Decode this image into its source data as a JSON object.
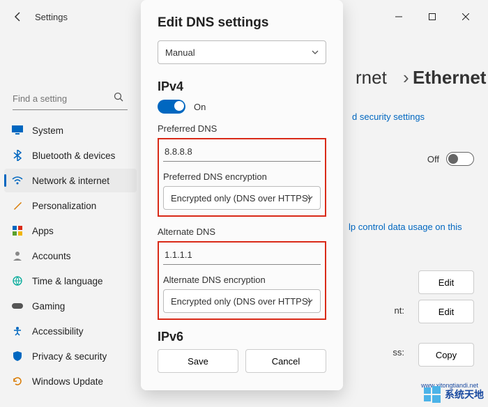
{
  "titlebar": {
    "title": "Settings"
  },
  "search": {
    "placeholder": "Find a setting"
  },
  "sidebar": {
    "items": [
      {
        "label": "System"
      },
      {
        "label": "Bluetooth & devices"
      },
      {
        "label": "Network & internet"
      },
      {
        "label": "Personalization"
      },
      {
        "label": "Apps"
      },
      {
        "label": "Accounts"
      },
      {
        "label": "Time & language"
      },
      {
        "label": "Gaming"
      },
      {
        "label": "Accessibility"
      },
      {
        "label": "Privacy & security"
      },
      {
        "label": "Windows Update"
      }
    ]
  },
  "breadcrumb": {
    "parent_partial": "rnet",
    "current": "Ethernet"
  },
  "main": {
    "security_link": "d security settings",
    "off_label": "Off",
    "usage_link": "lp control data usage on this",
    "edit_label": "Edit",
    "copy_label": "Copy",
    "nt_label": "nt:",
    "ss_label": "ss:"
  },
  "dialog": {
    "title": "Edit DNS settings",
    "mode_value": "Manual",
    "ipv4_header": "IPv4",
    "ipv4_toggle_label": "On",
    "preferred_dns_label": "Preferred DNS",
    "preferred_dns_value": "8.8.8.8",
    "preferred_enc_label": "Preferred DNS encryption",
    "preferred_enc_value": "Encrypted only (DNS over HTTPS)",
    "alternate_dns_label": "Alternate DNS",
    "alternate_dns_value": "1.1.1.1",
    "alternate_enc_label": "Alternate DNS encryption",
    "alternate_enc_value": "Encrypted only (DNS over HTTPS)",
    "ipv6_header": "IPv6",
    "save_label": "Save",
    "cancel_label": "Cancel"
  },
  "watermark": {
    "text": "系统天地",
    "url": "www.xitongtiandi.net"
  }
}
